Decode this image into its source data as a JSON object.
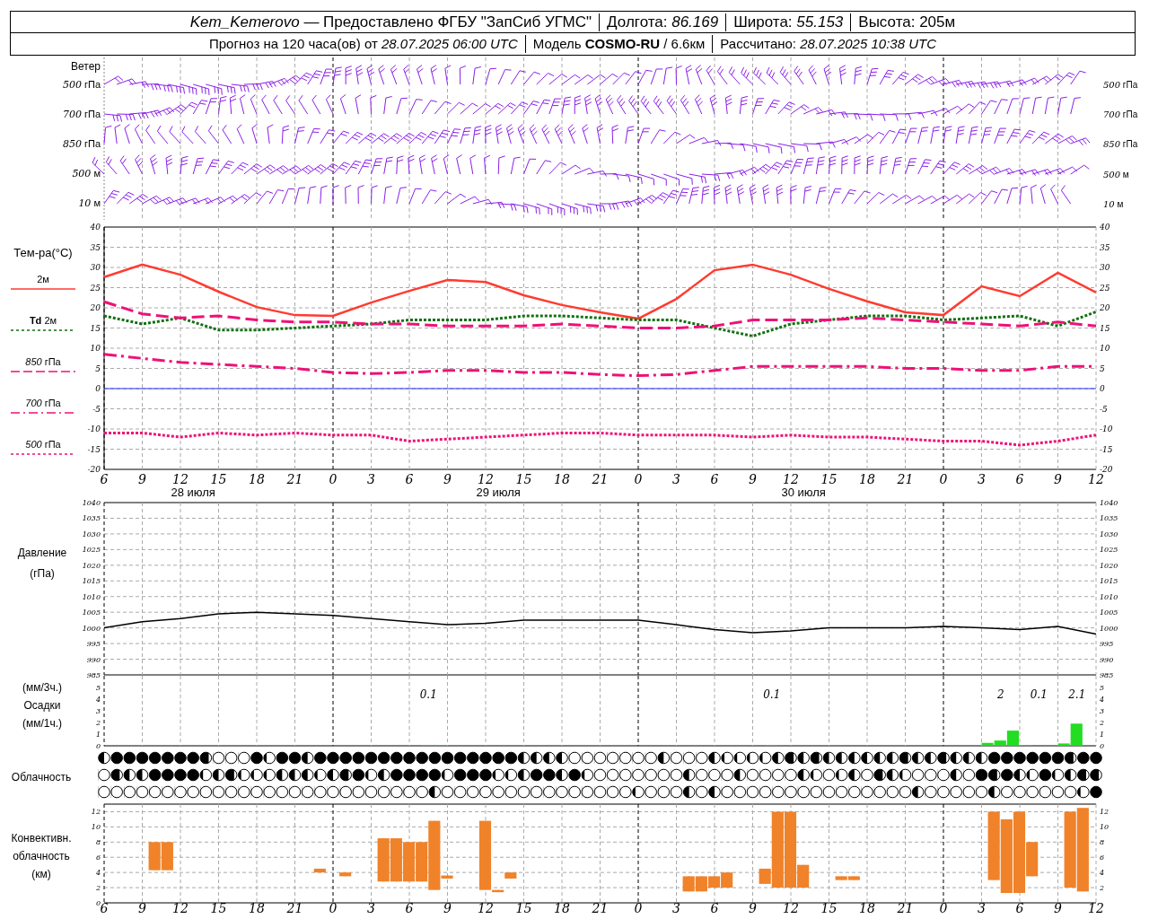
{
  "header": {
    "row_1": [
      "*Kem_Kemerovo* — Предоставлено ФГБУ \"ЗапСиб УГМС\"",
      "Долгота: *86.169*",
      "Широта: *55.153*",
      "Высота: 205м"
    ],
    "row_2": [
      "Прогноз на 120 часа(ов) от *28.07.2025 06:00 UTC*",
      "Модель **COSMO-RU** / 6.6км",
      "Рассчитано: *28.07.2025 10:38 UTC*"
    ]
  },
  "wind": {
    "title": "Ветер",
    "levels_left": [
      {
        "value": "500",
        "unit": "гПа"
      },
      {
        "value": "700",
        "unit": "гПа"
      },
      {
        "value": "850",
        "unit": "гПа"
      },
      {
        "value": "500",
        "unit": "м"
      },
      {
        "value": "10",
        "unit": "м"
      }
    ],
    "levels_right": [
      {
        "value": "500",
        "unit": "гПа"
      },
      {
        "value": "700",
        "unit": "гПа"
      },
      {
        "value": "850",
        "unit": "гПа"
      },
      {
        "value": "500",
        "unit": "м"
      },
      {
        "value": "10",
        "unit": "м"
      }
    ]
  },
  "temperature": {
    "title": "Тем-ра(°С)",
    "chart_data": {
      "type": "line",
      "grid": true,
      "categories": [
        "6",
        "9",
        "12",
        "15",
        "18",
        "21",
        "0",
        "3",
        "6",
        "9",
        "12",
        "15",
        "18",
        "21",
        "0",
        "3",
        "6",
        "9",
        "12",
        "15",
        "18",
        "21",
        "0",
        "3",
        "6",
        "9",
        "12"
      ],
      "ylim": [
        -20,
        40
      ],
      "yticks": [
        -20,
        -15,
        -10,
        -5,
        0,
        5,
        10,
        15,
        20,
        25,
        30,
        35,
        40
      ],
      "y2ticks": [
        -20,
        -15,
        -10,
        -5,
        0,
        5,
        10,
        15,
        20,
        25,
        30,
        35,
        40
      ],
      "y2lim": [
        -20,
        40
      ],
      "ref_lines": [
        {
          "axis": "y",
          "value": 0,
          "color": "#2233ff"
        }
      ],
      "annotations": [
        "28 июля",
        "29 июля",
        "30 июля"
      ],
      "series": [
        {
          "name": "2м",
          "color": "#ff3b30",
          "line_style": "solid",
          "values": [
            27.6,
            30.7,
            28.2,
            24,
            20.2,
            18.2,
            18,
            21.3,
            24.2,
            26.9,
            26.4,
            23.1,
            20.7,
            18.9,
            17.3,
            22.2,
            29.3,
            30.7,
            28.2,
            24.7,
            21.6,
            18.9,
            18.2,
            25.3,
            22.9,
            28.7,
            23.8
          ]
        },
        {
          "name": "**Td** 2м",
          "color": "#107010",
          "line_style": "dotted",
          "values": [
            18,
            16,
            17.5,
            14.5,
            14.5,
            15,
            15.5,
            16,
            17,
            17,
            17,
            18,
            18,
            17.5,
            17,
            17,
            15,
            13,
            16,
            17,
            18,
            18,
            17,
            17.5,
            18,
            15.5,
            19
          ]
        },
        {
          "name": "*850* гПа",
          "color": "#ee1177",
          "line_style": "dashed",
          "values": [
            21.5,
            18.5,
            17.5,
            18,
            17,
            16.5,
            16.5,
            16,
            16,
            15.5,
            15.5,
            15.5,
            16,
            15.5,
            15,
            15,
            15.5,
            17,
            17,
            17,
            17.5,
            17,
            16.5,
            16,
            15.5,
            16.5,
            15.5
          ]
        },
        {
          "name": "*700* гПа",
          "color": "#ee1177",
          "line_style": "dashdot",
          "values": [
            8.5,
            7.5,
            6.5,
            6,
            5.5,
            5,
            4,
            3.7,
            4,
            4.5,
            4.5,
            4,
            4,
            3.5,
            3.2,
            3.5,
            4.5,
            5.5,
            5.5,
            5.5,
            5.5,
            5,
            5,
            4.5,
            4.5,
            5.5,
            5.5
          ]
        },
        {
          "name": "*500* гПа",
          "color": "#ee1177",
          "line_style": "dotted",
          "values": [
            -11,
            -11,
            -12,
            -11,
            -11.5,
            -11,
            -11.5,
            -11.5,
            -13,
            -12.5,
            -12,
            -11.5,
            -11,
            -11,
            -11.5,
            -11.5,
            -11.5,
            -12,
            -11.5,
            -12,
            -12,
            -12.5,
            -13,
            -13,
            -14,
            -13,
            -11.5
          ]
        }
      ]
    }
  },
  "pressure": {
    "title": "Давление",
    "unit": "(гПа)",
    "chart_data": {
      "type": "line",
      "grid": true,
      "ylim": [
        985,
        1040
      ],
      "yticks": [
        985,
        990,
        995,
        1000,
        1005,
        1010,
        1015,
        1020,
        1025,
        1030,
        1035,
        1040
      ],
      "y2ticks": [
        985,
        990,
        995,
        1000,
        1005,
        1010,
        1015,
        1020,
        1025,
        1030,
        1035,
        1040
      ],
      "y2lim": [
        985,
        1040
      ],
      "series": [
        {
          "color": "#000000",
          "line_style": "solid",
          "values": [
            1000,
            1002,
            1003,
            1004.5,
            1005,
            1004.5,
            1004,
            1003,
            1002,
            1001,
            1001.5,
            1002.5,
            1002.5,
            1002.5,
            1002.5,
            1001,
            999.5,
            998.5,
            999,
            1000,
            1000,
            1000,
            1000.5,
            1000,
            999.5,
            1000.5,
            998
          ]
        }
      ]
    }
  },
  "precipitation": {
    "unit_top": "(мм/3ч.)",
    "title": "Осадки",
    "unit_bottom": "(мм/1ч.)",
    "chart_data": {
      "type": "bar",
      "grid": true,
      "ylim": [
        0,
        6
      ],
      "yticks": [
        0,
        1,
        2,
        3,
        4,
        5
      ],
      "y2ticks": [
        0,
        1,
        2,
        3,
        4,
        5
      ],
      "y2lim": [
        0,
        6
      ],
      "values": [
        null,
        null,
        null,
        null,
        null,
        null,
        null,
        null,
        null,
        null,
        null,
        null,
        null,
        null,
        null,
        null,
        null,
        null,
        null,
        null,
        null,
        null,
        null,
        null,
        null,
        0.05,
        0.05,
        null,
        null,
        null,
        null,
        null,
        null,
        null,
        null,
        null,
        null,
        null,
        null,
        null,
        null,
        null,
        null,
        null,
        null,
        null,
        null,
        null,
        null,
        null,
        null,
        null,
        0.05,
        null,
        null,
        null,
        null,
        null,
        null,
        null,
        null,
        null,
        null,
        null,
        null,
        null,
        null,
        null,
        null,
        0.25,
        0.45,
        1.3,
        0.05,
        null,
        null,
        0.2,
        1.9,
        null
      ],
      "annotations": [
        "0.1",
        "0.1",
        "2",
        "0.1",
        "2.1"
      ]
    }
  },
  "cloudiness": {
    "title": "Облачность",
    "rows": [
      [
        {
          "level": 0.5
        },
        {
          "level": 1
        },
        {
          "level": 1
        },
        {
          "level": 1
        },
        {
          "level": 1
        },
        {
          "level": 1
        },
        {
          "level": 1
        },
        {
          "level": 1
        },
        {
          "level": 0.75
        },
        {
          "level": 0
        },
        {
          "level": 0
        },
        {
          "level": 0
        },
        {
          "level": 1
        },
        {
          "level": 0.25
        },
        {
          "level": 1
        },
        {
          "level": 1
        },
        {
          "level": 0.5
        },
        {
          "level": 1
        },
        {
          "level": 1
        },
        {
          "level": 1
        },
        {
          "level": 1
        },
        {
          "level": 1
        },
        {
          "level": 1
        },
        {
          "level": 1
        },
        {
          "level": 1
        },
        {
          "level": 1
        },
        {
          "level": 1
        },
        {
          "level": 1
        },
        {
          "level": 1
        },
        {
          "level": 1
        },
        {
          "level": 1
        },
        {
          "level": 1
        },
        {
          "level": 1
        },
        {
          "level": 0.5
        },
        {
          "level": 0.5
        },
        {
          "level": 0.5
        },
        {
          "level": 0.5
        },
        {
          "level": 0
        },
        {
          "level": 0
        },
        {
          "level": 0
        },
        {
          "level": 0
        },
        {
          "level": 0
        },
        {
          "level": 0
        },
        {
          "level": 0
        },
        {
          "level": 0.5
        },
        {
          "level": 0
        },
        {
          "level": 0
        },
        {
          "level": 0
        },
        {
          "level": 0.5
        },
        {
          "level": 0.25
        },
        {
          "level": 0.25
        },
        {
          "level": 0.25
        },
        {
          "level": 0.25
        },
        {
          "level": 0.5
        },
        {
          "level": 0.75
        },
        {
          "level": 0.5
        },
        {
          "level": 0.75
        },
        {
          "level": 0.5
        },
        {
          "level": 0.5
        },
        {
          "level": 0.5
        },
        {
          "level": 0.5
        },
        {
          "level": 0.5
        },
        {
          "level": 0.5
        },
        {
          "level": 0.75
        },
        {
          "level": 0.5
        },
        {
          "level": 0.5
        },
        {
          "level": 0.75
        },
        {
          "level": 0.5
        },
        {
          "level": 0.5
        },
        {
          "level": 0.5
        },
        {
          "level": 1
        },
        {
          "level": 1
        },
        {
          "level": 1
        },
        {
          "level": 1
        },
        {
          "level": 1
        },
        {
          "level": 1
        },
        {
          "level": 0.75
        },
        {
          "level": 1
        },
        {
          "level": 1
        }
      ],
      [
        {
          "level": 0
        },
        {
          "level": 0.75
        },
        {
          "level": 0.5
        },
        {
          "level": 0.5
        },
        {
          "level": 1
        },
        {
          "level": 1
        },
        {
          "level": 1
        },
        {
          "level": 1
        },
        {
          "level": 0.25
        },
        {
          "level": 0.5
        },
        {
          "level": 0.75
        },
        {
          "level": 0.25
        },
        {
          "level": 0.25
        },
        {
          "level": 0.25
        },
        {
          "level": 0.5
        },
        {
          "level": 0.5
        },
        {
          "level": 0.5
        },
        {
          "level": 0.25
        },
        {
          "level": 0.5
        },
        {
          "level": 0.75
        },
        {
          "level": 1
        },
        {
          "level": 0.25
        },
        {
          "level": 0.5
        },
        {
          "level": 1
        },
        {
          "level": 1
        },
        {
          "level": 1
        },
        {
          "level": 1
        },
        {
          "level": 0.25
        },
        {
          "level": 1
        },
        {
          "level": 1
        },
        {
          "level": 1
        },
        {
          "level": 0.25
        },
        {
          "level": 0.25
        },
        {
          "level": 0.5
        },
        {
          "level": 1
        },
        {
          "level": 1
        },
        {
          "level": 0.5
        },
        {
          "level": 1
        },
        {
          "level": 0.25
        },
        {
          "level": 0
        },
        {
          "level": 0
        },
        {
          "level": 0
        },
        {
          "level": 0
        },
        {
          "level": 0
        },
        {
          "level": 0
        },
        {
          "level": 0
        },
        {
          "level": 0.5
        },
        {
          "level": 0
        },
        {
          "level": 0
        },
        {
          "level": 0
        },
        {
          "level": 0.5
        },
        {
          "level": 0
        },
        {
          "level": 0
        },
        {
          "level": 0
        },
        {
          "level": 0
        },
        {
          "level": 0.5
        },
        {
          "level": 0.25
        },
        {
          "level": 0
        },
        {
          "level": 0.25
        },
        {
          "level": 0.5
        },
        {
          "level": 0
        },
        {
          "level": 0.75
        },
        {
          "level": 0.5
        },
        {
          "level": 0.25
        },
        {
          "level": 0
        },
        {
          "level": 0
        },
        {
          "level": 0
        },
        {
          "level": 0.5
        },
        {
          "level": 0
        },
        {
          "level": 1
        },
        {
          "level": 0.75
        },
        {
          "level": 1
        },
        {
          "level": 0.5
        },
        {
          "level": 0.25
        },
        {
          "level": 1
        },
        {
          "level": 0.25
        },
        {
          "level": 0.5
        },
        {
          "level": 0.75
        },
        {
          "level": 0.75
        }
      ],
      [
        {
          "level": 0
        },
        {
          "level": 0
        },
        {
          "level": 0
        },
        {
          "level": 0
        },
        {
          "level": 0
        },
        {
          "level": 0
        },
        {
          "level": 0
        },
        {
          "level": 0
        },
        {
          "level": 0
        },
        {
          "level": 0
        },
        {
          "level": 0
        },
        {
          "level": 0
        },
        {
          "level": 0
        },
        {
          "level": 0
        },
        {
          "level": 0
        },
        {
          "level": 0
        },
        {
          "level": 0
        },
        {
          "level": 0
        },
        {
          "level": 0
        },
        {
          "level": 0
        },
        {
          "level": 0
        },
        {
          "level": 0
        },
        {
          "level": 0
        },
        {
          "level": 0
        },
        {
          "level": 0
        },
        {
          "level": 0
        },
        {
          "level": 0.5
        },
        {
          "level": 0
        },
        {
          "level": 0
        },
        {
          "level": 0
        },
        {
          "level": 0
        },
        {
          "level": 0
        },
        {
          "level": 0
        },
        {
          "level": 0
        },
        {
          "level": 0
        },
        {
          "level": 0
        },
        {
          "level": 0
        },
        {
          "level": 0
        },
        {
          "level": 0
        },
        {
          "level": 0
        },
        {
          "level": 0
        },
        {
          "level": 0
        },
        {
          "level": 0.25
        },
        {
          "level": 0
        },
        {
          "level": 0
        },
        {
          "level": 0
        },
        {
          "level": 0.5
        },
        {
          "level": 0
        },
        {
          "level": 0.5
        },
        {
          "level": 0
        },
        {
          "level": 0
        },
        {
          "level": 0
        },
        {
          "level": 0
        },
        {
          "level": 0
        },
        {
          "level": 0
        },
        {
          "level": 0
        },
        {
          "level": 0
        },
        {
          "level": 0
        },
        {
          "level": 0
        },
        {
          "level": 0
        },
        {
          "level": 0
        },
        {
          "level": 0
        },
        {
          "level": 0
        },
        {
          "level": 0
        },
        {
          "level": 0.5
        },
        {
          "level": 0
        },
        {
          "level": 0
        },
        {
          "level": 0
        },
        {
          "level": 0
        },
        {
          "level": 0
        },
        {
          "level": 0.5
        },
        {
          "level": 0
        },
        {
          "level": 0
        },
        {
          "level": 0
        },
        {
          "level": 0
        },
        {
          "level": 0
        },
        {
          "level": 0
        },
        {
          "level": 0.25
        },
        {
          "level": 1
        }
      ]
    ]
  },
  "convective_clouds": {
    "title_1": "Конвективн.",
    "title_2": "облачность",
    "unit": "(км)",
    "chart_data": {
      "type": "candlestick",
      "grid": true,
      "ylim": [
        0,
        13
      ],
      "yticks": [
        0,
        2,
        4,
        6,
        8,
        10,
        12
      ],
      "y2ticks": [
        2,
        4,
        6,
        8,
        10,
        12
      ],
      "y2lim": [
        0,
        13
      ],
      "categories": [
        "6",
        null,
        null,
        "9",
        null,
        null,
        "12",
        null,
        null,
        "15",
        null,
        null,
        "18",
        null,
        null,
        "21",
        null,
        null,
        "0",
        null,
        null,
        "3",
        null,
        null,
        "6",
        null,
        null,
        "9",
        null,
        null,
        "12",
        null,
        null,
        "15",
        null,
        null,
        "18",
        null,
        null,
        "21",
        null,
        null,
        "0",
        null,
        null,
        "3",
        null,
        null,
        "6",
        null,
        null,
        "9",
        null,
        null,
        "12",
        null,
        null,
        "15",
        null,
        null,
        "18",
        null,
        null,
        "21",
        null,
        null,
        "0",
        null,
        null,
        "3",
        null,
        null,
        "6",
        null,
        null,
        "9",
        null,
        null,
        "12"
      ],
      "series": [
        {
          "color": "#f0822a",
          "ohlc": [
            null,
            null,
            null,
            null,
            [
              4.3,
              8,
              4.3,
              8
            ],
            [
              4.3,
              8,
              4.3,
              8
            ],
            null,
            null,
            null,
            null,
            null,
            null,
            null,
            null,
            null,
            null,
            null,
            [
              4,
              4.5,
              4,
              4.5
            ],
            null,
            [
              3.5,
              4,
              3.5,
              4
            ],
            null,
            null,
            [
              2.8,
              8.5,
              2.8,
              8.5
            ],
            [
              2.8,
              8.5,
              2.8,
              8.5
            ],
            [
              2.8,
              8,
              2.8,
              8
            ],
            [
              2.8,
              8,
              2.8,
              8
            ],
            [
              1.7,
              10.8,
              1.7,
              10.8
            ],
            [
              3.2,
              3.6,
              3.2,
              3.6
            ],
            null,
            null,
            [
              1.7,
              10.8,
              1.7,
              10.8
            ],
            [
              1.4,
              1.7,
              1.4,
              1.7
            ],
            [
              3.2,
              4,
              3.2,
              4
            ],
            null,
            null,
            null,
            null,
            null,
            null,
            null,
            null,
            null,
            null,
            null,
            null,
            null,
            [
              1.5,
              3.5,
              1.5,
              3.5
            ],
            [
              1.5,
              3.5,
              1.5,
              3.5
            ],
            [
              2,
              3.5,
              2,
              3.5
            ],
            [
              2,
              4,
              2,
              4
            ],
            null,
            null,
            [
              2.5,
              4.5,
              2.5,
              4.5
            ],
            [
              2,
              12,
              2,
              12
            ],
            [
              2,
              12,
              2,
              12
            ],
            [
              2,
              5,
              2,
              5
            ],
            null,
            null,
            [
              3,
              3.5,
              3,
              3.5
            ],
            [
              3,
              3.5,
              3,
              3.5
            ],
            null,
            null,
            null,
            null,
            null,
            null,
            null,
            null,
            null,
            null,
            [
              3,
              12,
              3,
              12
            ],
            [
              1.3,
              11,
              1.3,
              11
            ],
            [
              1.3,
              12,
              1.3,
              12
            ],
            [
              3.5,
              8,
              3.5,
              8
            ],
            null,
            null,
            [
              2,
              12,
              2,
              12
            ],
            [
              1.5,
              12.5,
              1.5,
              12.5
            ],
            null
          ]
        }
      ]
    }
  }
}
